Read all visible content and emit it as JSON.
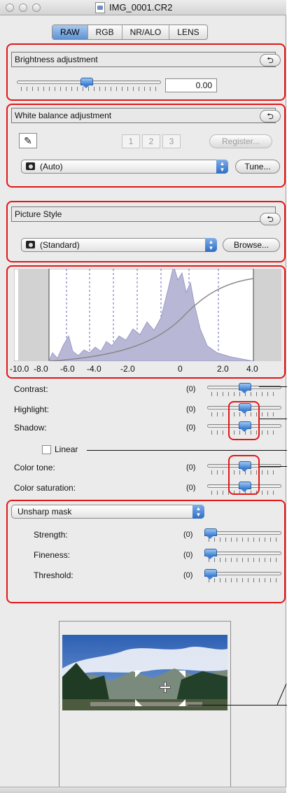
{
  "window": {
    "title": "IMG_0001.CR2"
  },
  "tabs": [
    "RAW",
    "RGB",
    "NR/ALO",
    "LENS"
  ],
  "active_tab": "RAW",
  "brightness": {
    "header": "Brightness adjustment",
    "value": "0.00",
    "slider_position": 0.48
  },
  "white_balance": {
    "header": "White balance adjustment",
    "number_buttons": [
      "1",
      "2",
      "3"
    ],
    "register_label": "Register...",
    "select_value": "(Auto)",
    "tune_label": "Tune..."
  },
  "picture_style": {
    "header": "Picture Style",
    "select_value": "(Standard)",
    "browse_label": "Browse..."
  },
  "tone_curve": {
    "x_ticks": [
      "-10.0",
      "-8.0",
      "-6.0",
      "-4.0",
      "-2.0",
      "0",
      "2.0",
      "4.0"
    ]
  },
  "adjustments": [
    {
      "label": "Contrast:",
      "value": "(0)",
      "position": 0.5
    },
    {
      "label": "Highlight:",
      "value": "(0)",
      "position": 0.5
    },
    {
      "label": "Shadow:",
      "value": "(0)",
      "position": 0.5
    },
    {
      "label": "Color tone:",
      "value": "(0)",
      "position": 0.5
    },
    {
      "label": "Color saturation:",
      "value": "(0)",
      "position": 0.5
    }
  ],
  "linear_label": "Linear",
  "sharpness": {
    "mode": "Unsharp mask",
    "items": [
      {
        "label": "Strength:",
        "value": "(0)",
        "position": 0.0
      },
      {
        "label": "Fineness:",
        "value": "(0)",
        "position": 0.0
      },
      {
        "label": "Threshold:",
        "value": "(0)",
        "position": 0.0
      }
    ]
  },
  "colors": {
    "highlight_red": "#e21717",
    "accent_blue": "#4a86d6",
    "histogram_fill": "#b8b8d6"
  }
}
